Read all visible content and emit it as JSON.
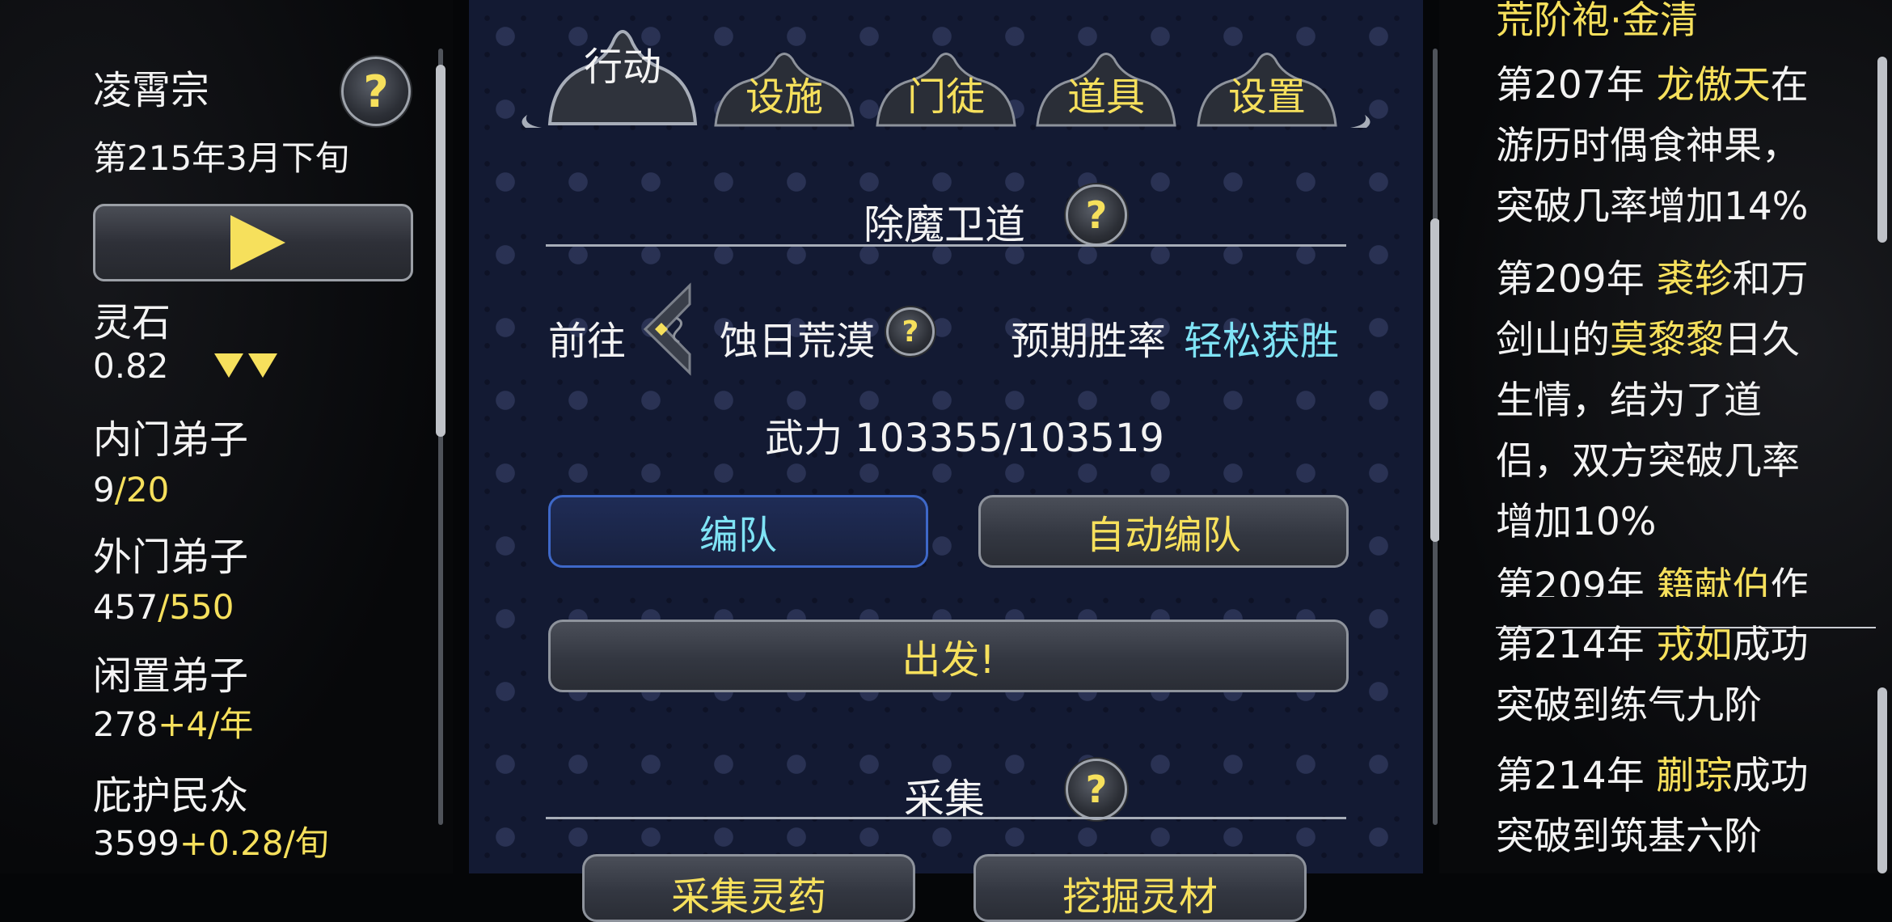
{
  "sect": {
    "name": "凌霄宗",
    "date": "第215年3月下旬",
    "spirit_stone_label": "灵石",
    "spirit_stone_value": "0.82",
    "inner_disciples_label": "内门弟子",
    "inner_current": "9",
    "inner_max": "/20",
    "outer_disciples_label": "外门弟子",
    "outer_current": "457",
    "outer_max": "/550",
    "idle_disciples_label": "闲置弟子",
    "idle_current": "278",
    "idle_rate": "+4/年",
    "protected_label": "庇护民众",
    "protected_current": "3599",
    "protected_rate": "+0.28/旬"
  },
  "tabs": [
    {
      "label": "行动",
      "active": true
    },
    {
      "label": "设施",
      "active": false
    },
    {
      "label": "门徒",
      "active": false
    },
    {
      "label": "道具",
      "active": false
    },
    {
      "label": "设置",
      "active": false
    }
  ],
  "expedition": {
    "section_title": "除魔卫道",
    "goto_label": "前往",
    "destination": "蚀日荒漠",
    "win_rate_label": "预期胜率",
    "win_rate_value": "轻松获胜",
    "power_text": "武力 103355/103519",
    "formation_button": "编队",
    "auto_formation_button": "自动编队",
    "depart_button": "出发!"
  },
  "gather": {
    "section_title": "采集",
    "button_1": "采集灵药",
    "button_2": "挖掘灵材"
  },
  "log": {
    "top_partial": "荒阶袍·金清",
    "entries": [
      {
        "parts": [
          {
            "t": "第207年 ",
            "c": ""
          },
          {
            "t": "龙傲天",
            "c": "gold"
          },
          {
            "t": "在游历时偶食神果，突破几率增加14%",
            "c": ""
          }
        ]
      },
      {
        "parts": [
          {
            "t": "第209年 ",
            "c": ""
          },
          {
            "t": "裘轸",
            "c": "gold"
          },
          {
            "t": "和万剑山的",
            "c": ""
          },
          {
            "t": "莫黎黎",
            "c": "gold"
          },
          {
            "t": "日久生情，结为了道侣，双方突破几率增加10%",
            "c": ""
          }
        ]
      },
      {
        "parts": [
          {
            "t": "第209年 ",
            "c": ""
          },
          {
            "t": "籍献伯",
            "c": "gold"
          },
          {
            "t": "作",
            "c": ""
          }
        ]
      },
      {
        "parts": [
          {
            "t": "第214年 ",
            "c": ""
          },
          {
            "t": "戎如",
            "c": "gold"
          },
          {
            "t": "成功突破到练气九阶",
            "c": ""
          }
        ]
      },
      {
        "parts": [
          {
            "t": "第214年 ",
            "c": ""
          },
          {
            "t": "蒯琮",
            "c": "gold"
          },
          {
            "t": "成功突破到筑基六阶",
            "c": ""
          }
        ]
      }
    ]
  },
  "colors": {
    "gold": "#f6e05c",
    "cyan": "#7fe3f5",
    "panel_bg": "#131a33",
    "formation_border": "#3e68c8"
  }
}
